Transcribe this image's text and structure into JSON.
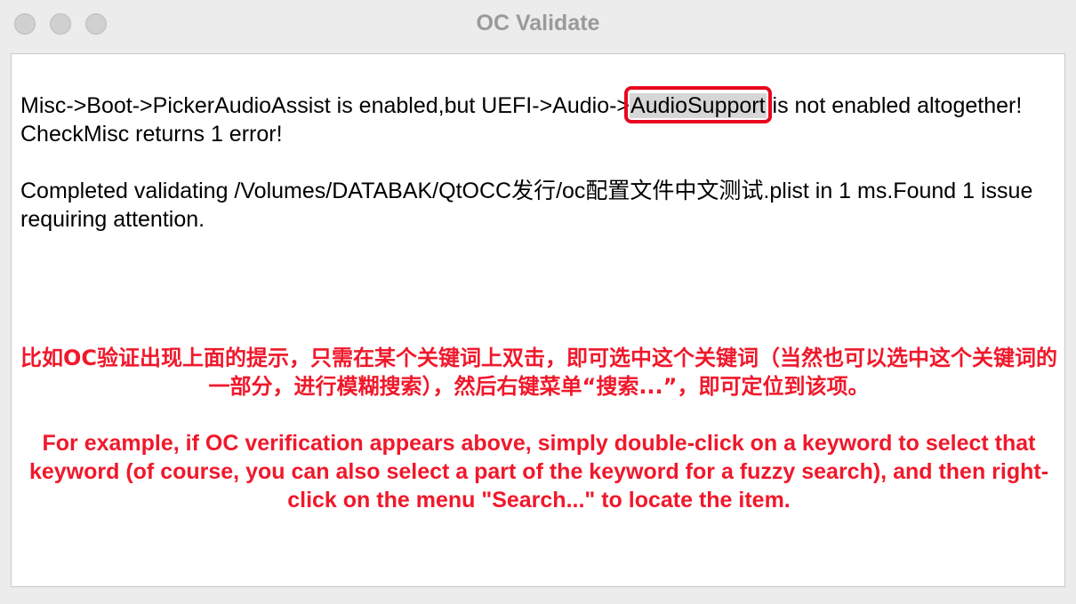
{
  "window": {
    "title": "OC Validate"
  },
  "log": {
    "line1_before": "Misc->Boot->PickerAudioAssist is enabled,but UEFI->Audio->",
    "line1_highlight": "AudioSupport",
    "line1_after": " is not enabled altogether!",
    "line2": "CheckMisc returns 1 error!",
    "line3": "Completed validating /Volumes/DATABAK/QtOCC发行/oc配置文件中文测试.plist in 1 ms.Found 1 issue requiring attention."
  },
  "annotation": {
    "chinese": "比如OC验证出现上面的提示，只需在某个关键词上双击，即可选中这个关键词（当然也可以选中这个关键词的一部分，进行模糊搜索），然后右键菜单“搜索...”，即可定位到该项。",
    "english": "For example, if OC verification appears above, simply double-click on a keyword to select that keyword (of course, you can also select a part of the keyword for a fuzzy search), and then right-click on the menu \"Search...\" to locate the item.",
    "color": "#f0182b"
  },
  "highlight_box_color": "#e8071e"
}
